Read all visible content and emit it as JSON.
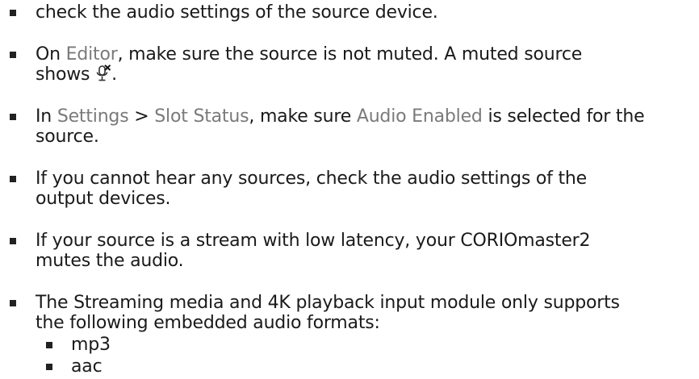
{
  "items": [
    {
      "lines": [
        {
          "text": "check the audio settings of the source device."
        }
      ]
    },
    {
      "prefix": "On ",
      "menu_editor": "Editor",
      "rest_line1": ", make sure the source is not muted. A muted source",
      "line2_text": "shows",
      "line2_end": ".",
      "icon": "muted-microphone-icon"
    },
    {
      "prefix": "In ",
      "menu_settings": "Settings",
      "sep": " > ",
      "menu_slot_status": "Slot Status",
      "mid": ", make sure ",
      "menu_audio_enabled": "Audio Enabled",
      "rest_line1": " is selected for the",
      "line2_text": "source."
    },
    {
      "line1": "If you cannot hear any sources, check the audio settings of the",
      "line2": "output devices."
    },
    {
      "line1": "If your source is a stream with low latency, your CORIOmaster2",
      "line2": "mutes the audio."
    },
    {
      "line1": "The Streaming media and 4K playback input module only supports",
      "line2": "the following embedded audio formats:"
    }
  ],
  "formats": [
    "mp3",
    "aac"
  ],
  "colors": {
    "text": "#1a1a1a",
    "menu_reference": "#7a7a7a",
    "bullet": "#222222"
  }
}
